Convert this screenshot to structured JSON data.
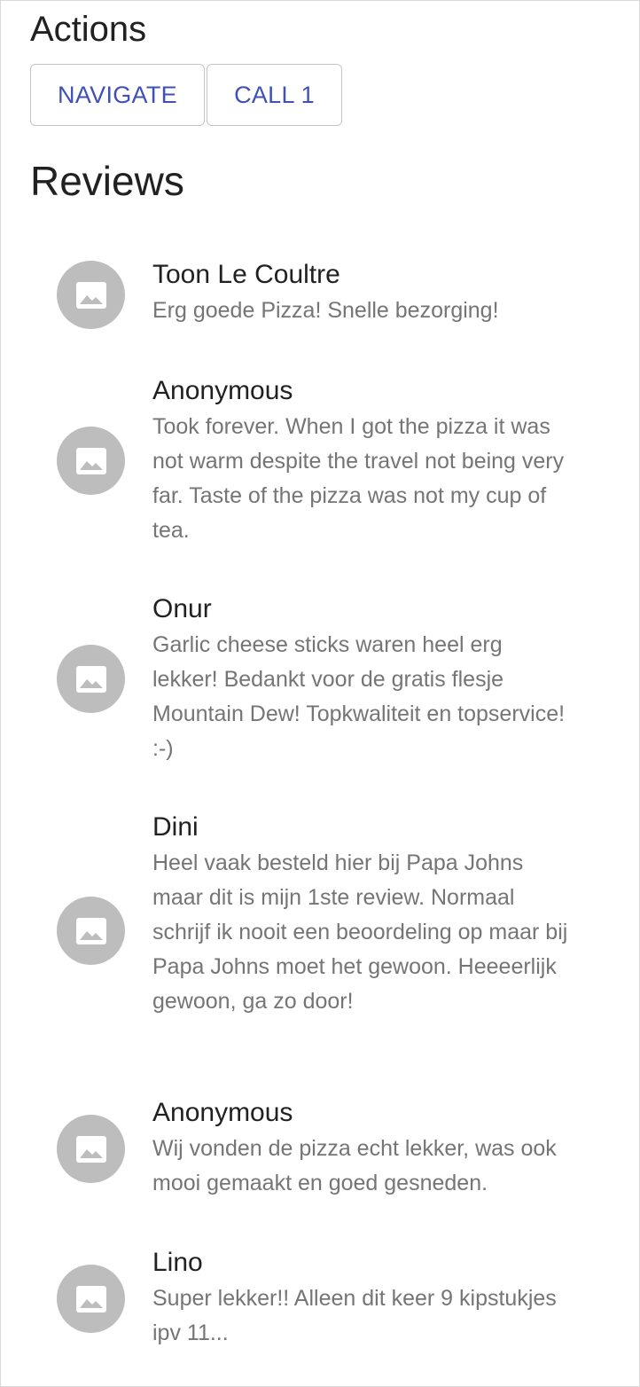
{
  "actions": {
    "title": "Actions",
    "navigate_label": "NAVIGATE",
    "call_label": "CALL 1"
  },
  "reviews": {
    "title": "Reviews",
    "items": [
      {
        "name": "Toon Le Coultre",
        "text": "Erg goede Pizza! Snelle bezorging!"
      },
      {
        "name": "Anonymous",
        "text": "Took forever. When I got the pizza it was not warm despite the travel not being very far. Taste of the pizza was not my cup of tea."
      },
      {
        "name": "Onur",
        "text": "Garlic cheese sticks waren heel erg lekker! Bedankt voor de gratis flesje Mountain Dew! Topkwaliteit en topservice! :-)"
      },
      {
        "name": "Dini",
        "text": "Heel vaak besteld hier bij Papa Johns maar dit is mijn 1ste review. Normaal schrijf ik nooit een beoordeling op maar bij Papa Johns moet het gewoon. Heeeerlijk gewoon, ga zo door!"
      },
      {
        "name": "Anonymous",
        "text": "Wij vonden de pizza echt lekker, was ook mooi gemaakt en goed gesneden."
      },
      {
        "name": "Lino",
        "text": "Super lekker!! Alleen dit keer 9 kipstukjes ipv 11..."
      }
    ]
  },
  "avatar_icon": "image-placeholder-icon",
  "colors": {
    "accent": "#3f51b5",
    "avatar_bg": "#bdbdbd",
    "secondary_text": "#757575"
  }
}
